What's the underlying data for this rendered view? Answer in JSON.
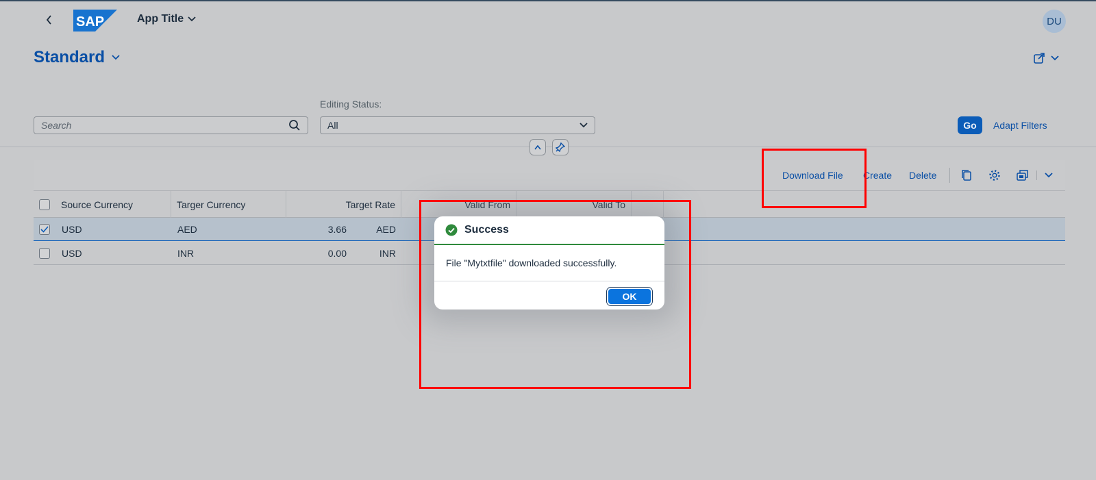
{
  "shell": {
    "logo_text": "SAP",
    "app_title": "App Title",
    "avatar_initials": "DU"
  },
  "page": {
    "variant_title": "Standard"
  },
  "filters": {
    "search_placeholder": "Search",
    "editing_status_label": "Editing Status:",
    "editing_status_value": "All",
    "go_label": "Go",
    "adapt_filters_label": "Adapt Filters"
  },
  "toolbar": {
    "download_label": "Download File",
    "create_label": "Create",
    "delete_label": "Delete"
  },
  "table": {
    "columns": [
      "Source Currency",
      "Targer Currency",
      "Target Rate",
      "Valid From",
      "Valid To"
    ],
    "rows": [
      {
        "source": "USD",
        "target": "AED",
        "rate": "3.66",
        "rate_unit": "AED",
        "selected": true
      },
      {
        "source": "USD",
        "target": "INR",
        "rate": "0.00",
        "rate_unit": "INR",
        "selected": false
      }
    ]
  },
  "dialog": {
    "title": "Success",
    "message": "File \"Mytxtfile\" downloaded successfully.",
    "ok_label": "OK"
  },
  "colors": {
    "accent": "#0b5cb8",
    "success": "#2f8a3c",
    "highlight": "#ff0000"
  }
}
